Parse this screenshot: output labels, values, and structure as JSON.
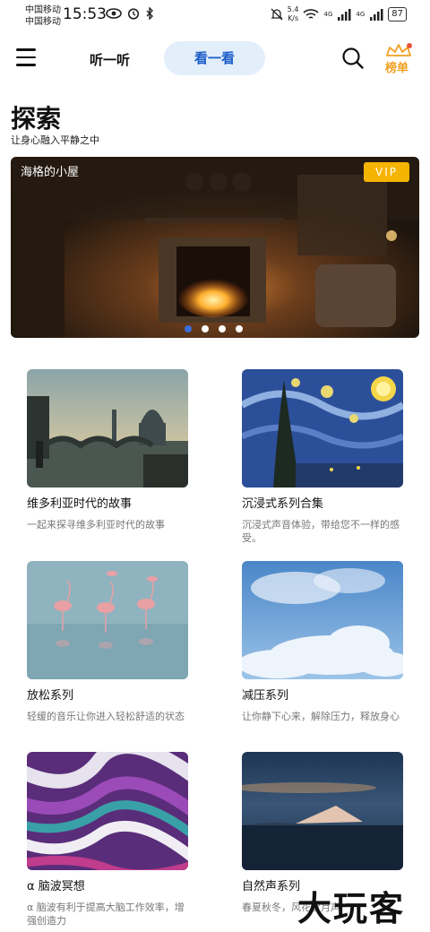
{
  "status_bar": {
    "carrier_1": "中国移动",
    "carrier_2": "中国移动",
    "time": "15:53",
    "speed_value": "5.4",
    "speed_unit": "K/s",
    "net_1": "4G",
    "net_2": "4G",
    "battery": "87"
  },
  "header": {
    "tab_listen": "听一听",
    "tab_watch": "看一看",
    "rank_label": "榜单"
  },
  "section": {
    "title": "探索",
    "subtitle": "让身心融入平静之中"
  },
  "banner": {
    "title": "海格的小屋",
    "badge": "VIP",
    "page_count": 4,
    "active_page": 1
  },
  "cards": [
    {
      "title": "维多利亚时代的故事",
      "desc": "一起来探寻维多利亚时代的故事"
    },
    {
      "title": "沉浸式系列合集",
      "desc": "沉浸式声音体验，带给您不一样的感受。"
    },
    {
      "title": "放松系列",
      "desc": "轻缓的音乐让你进入轻松舒适的状态"
    },
    {
      "title": "减压系列",
      "desc": "让你静下心来，解除压力，释放身心"
    },
    {
      "title": "α 脑波冥想",
      "desc": "α 脑波有利于提高大脑工作效率，增强创造力"
    },
    {
      "title": "自然声系列",
      "desc": "春夏秋冬，风花雪月声"
    }
  ],
  "watermark": "大玩客",
  "colors": {
    "accent": "#1c5fc9",
    "tab_bg": "#e3eefb",
    "vip": "#f5b400",
    "rank": "#f0a020"
  }
}
